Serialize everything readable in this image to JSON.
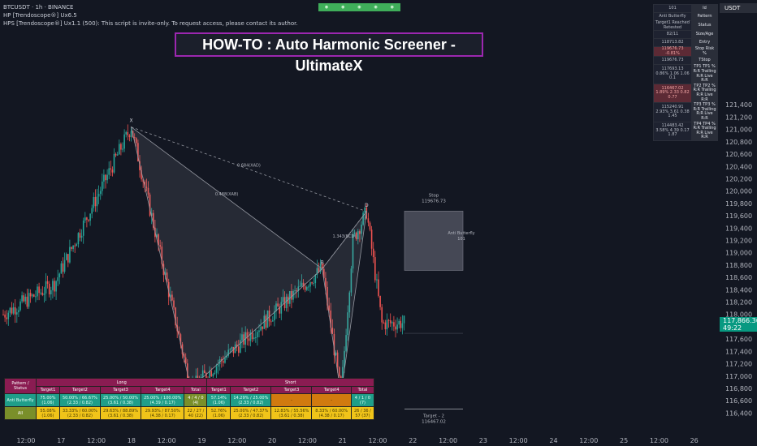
{
  "header": {
    "symbol_line": "BTCUSDT · 1h · BINANCE",
    "indicator_1": "HP [Trendoscope®] Ux6.5",
    "indicator_2": "HPS [Trendoscope®] Ux1.1 (500): This script is invite-only. To request access, please contact its author."
  },
  "title_banner": "HOW-TO : Auto Harmonic Screener - UltimateX",
  "currency": "USDT",
  "colors": {
    "up": "#26a69a",
    "down": "#ef5350",
    "banner_border": "#9c27b0",
    "price_tag": "#089981"
  },
  "chart_data": {
    "type": "candlestick",
    "ylim": [
      116300,
      122600
    ],
    "y_ticks": [
      121400,
      121200,
      121000,
      120800,
      120600,
      120400,
      120200,
      120000,
      119800,
      119600,
      119400,
      119200,
      119000,
      118800,
      118600,
      118400,
      118200,
      118000,
      117600,
      117400,
      117200,
      117000,
      116800,
      116600,
      116400
    ],
    "x_ticks": [
      "12:00",
      "17",
      "12:00",
      "18",
      "12:00",
      "19",
      "12:00",
      "20",
      "12:00",
      "21",
      "12:00",
      "22",
      "12:00",
      "23",
      "12:00",
      "24",
      "12:00",
      "25",
      "12:00",
      "26"
    ],
    "grid": false,
    "current_price": "117,866.36",
    "countdown": "49:22",
    "pattern": {
      "name": "Anti Butterfly",
      "points": [
        {
          "label": "X",
          "bar": 75,
          "price": 121040
        },
        {
          "label": "A",
          "bar": 110,
          "price": 116800
        },
        {
          "label": "B",
          "bar": 187,
          "price": 118740
        },
        {
          "label": "C",
          "bar": 198,
          "price": 116700
        },
        {
          "label": "D",
          "bar": 213,
          "price": 119670
        }
      ],
      "ratios": [
        "0.684(XAD)",
        "0.488(XAB)",
        "1.343(BCD)"
      ],
      "stop_label": "Stop",
      "stop_value": "119676.73",
      "box_label": "Anti Butterfly",
      "box_id": "101",
      "target_label": "Target - 2",
      "target_value": "116467.02"
    }
  },
  "right_table": [
    {
      "v": "101",
      "k": "Id"
    },
    {
      "v": "Anti Butterfly",
      "k": "Pattern"
    },
    {
      "v": "Target1 Reached Retested",
      "k": "Status"
    },
    {
      "v": "82/11",
      "k": "Size/Age"
    },
    {
      "v": "118713.82",
      "k": "Entry"
    },
    {
      "v": "119676.73 -0.81%",
      "k": "Stop Risk %",
      "red": true
    },
    {
      "v": "119676.73",
      "k": "TStop"
    },
    {
      "v": "117693.13 0.86% 1.06 1.06 0.1",
      "k": "TP1 TP1 % R:R Trailing R:R Live R:R"
    },
    {
      "v": "116467.02 1.89% 2.33 0.82 0.77",
      "k": "TP2 TP2 % R:R Trailing R:R Live R:R",
      "red": true
    },
    {
      "v": "115240.91 2.93% 3.61 0.38 1.45",
      "k": "TP3 TP3 % R:R Trailing R:R Live R:R"
    },
    {
      "v": "114483.42 3.58% 4.39 0.17 1.87",
      "k": "TP4 TP4 % R:R Trailing R:R Live R:R"
    }
  ],
  "bottom_table": {
    "corner": "Pattern / Status",
    "long": "Long",
    "short": "Short",
    "columns": [
      "Target1",
      "Target2",
      "Target3",
      "Target4",
      "Total",
      "Target1",
      "Target2",
      "Target3",
      "Target4",
      "Total"
    ],
    "rows": [
      {
        "name": "Anti Butterfly",
        "cells": [
          "75.00% (1.06)",
          "50.00% / 66.67% (2.33 / 0.82)",
          "25.00% / 50.00% (3.61 / 0.38)",
          "25.00% / 100.00% (4.39 / 0.17)",
          "4 / 4 / 0 (4)",
          "57.14% (1.06)",
          "14.29% / 25.00% (2.33 / 0.82)",
          "-",
          "-",
          "4 / 1 / 0 (7)"
        ]
      },
      {
        "name": "All",
        "cells": [
          "55.08% (1.06)",
          "33.33% / 60.00% (2.33 / 0.82)",
          "29.63% / 88.89% (3.61 / 0.38)",
          "29.93% / 87.50% (4.38 / 0.17)",
          "22 / 27 / 40 (22)",
          "52.76% (1.06)",
          "25.00% / 47.37% (2.33 / 0.82)",
          "12.83% / 55.56% (3.61 / 0.38)",
          "8.33% / 60.00% (4.38 / 0.17)",
          "26 / 36 / 57 (37)"
        ]
      }
    ]
  }
}
